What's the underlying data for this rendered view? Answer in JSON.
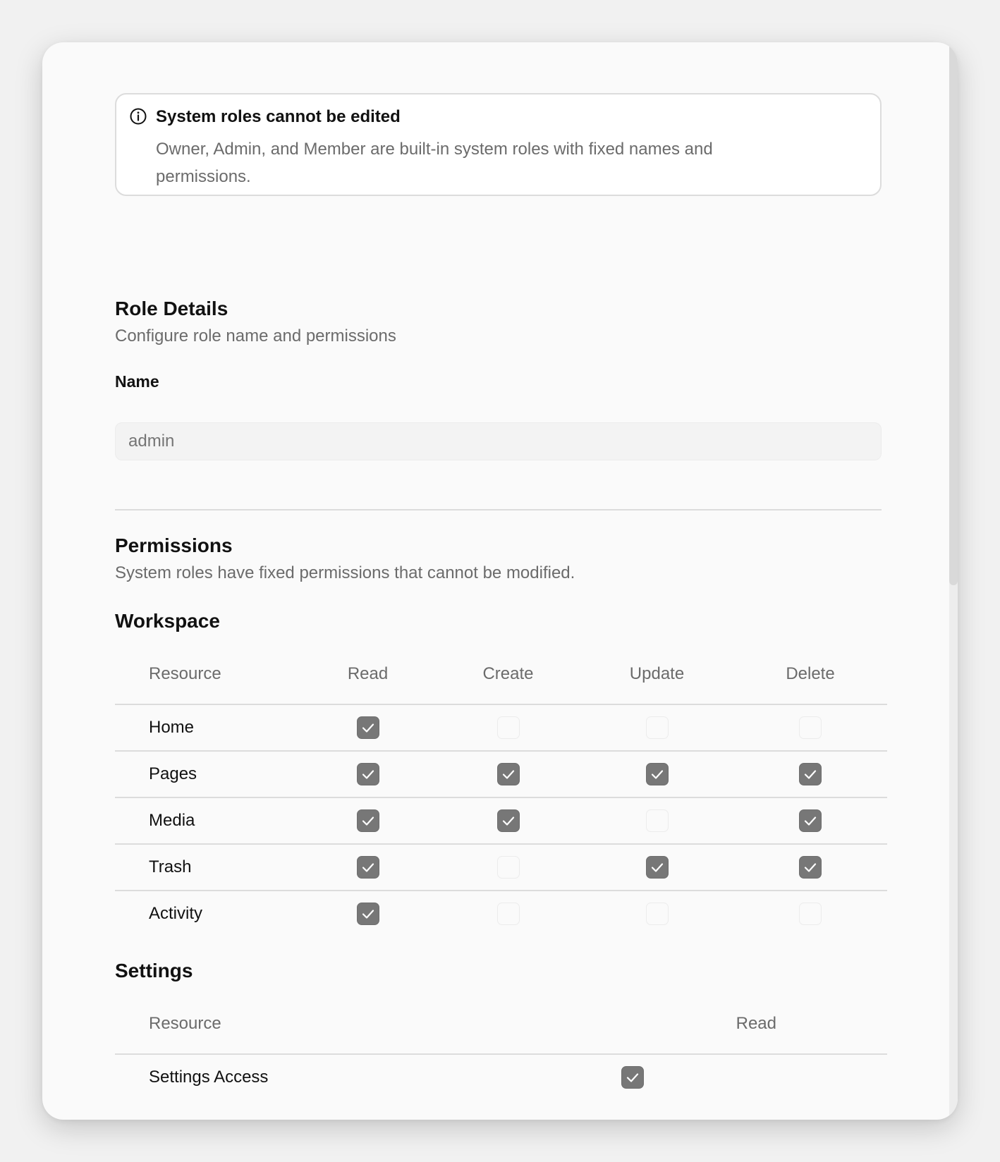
{
  "alert": {
    "icon": "info-icon",
    "title": "System roles cannot be edited",
    "body": "Owner, Admin, and Member are built-in system roles with fixed names and permissions."
  },
  "role_details": {
    "title": "Role Details",
    "subtitle": "Configure role name and permissions",
    "name_label": "Name",
    "name_placeholder": "admin"
  },
  "permissions": {
    "title": "Permissions",
    "subtitle": "System roles have fixed permissions that cannot be modified."
  },
  "workspace": {
    "title": "Workspace",
    "columns": [
      "Resource",
      "Read",
      "Create",
      "Update",
      "Delete"
    ],
    "rows": [
      {
        "resource": "Home",
        "read": true,
        "create": false,
        "update": false,
        "delete": false
      },
      {
        "resource": "Pages",
        "read": true,
        "create": true,
        "update": true,
        "delete": true
      },
      {
        "resource": "Media",
        "read": true,
        "create": true,
        "update": false,
        "delete": true
      },
      {
        "resource": "Trash",
        "read": true,
        "create": false,
        "update": true,
        "delete": true
      },
      {
        "resource": "Activity",
        "read": true,
        "create": false,
        "update": false,
        "delete": false
      }
    ]
  },
  "settings": {
    "title": "Settings",
    "columns": [
      "Resource",
      "Read"
    ],
    "rows": [
      {
        "resource": "Settings Access",
        "read": true
      }
    ]
  },
  "colors": {
    "checkbox_checked": "#777777",
    "card_bg": "#fafafa",
    "muted_text": "#6b6b6b"
  }
}
